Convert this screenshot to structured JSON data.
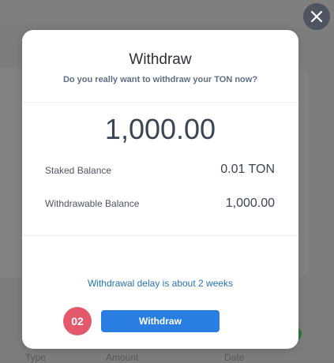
{
  "modal": {
    "title": "Withdraw",
    "subtitle": "Do you really want to withdraw your TON now?",
    "amount": "1,000.00",
    "rows": [
      {
        "label": "Staked Balance",
        "value": "0.01 TON"
      },
      {
        "label": "Withdrawable Balance",
        "value": "1,000.00"
      }
    ],
    "delay_text": "Withdrawal delay is about 2 weeks",
    "step_badge": "02",
    "withdraw_label": "Withdraw"
  },
  "background": {
    "columns": [
      "Type",
      "Amount",
      "Date"
    ]
  },
  "icons": {
    "close": "close-icon"
  },
  "colors": {
    "primary_button": "#2a7de1",
    "step_badge": "#e4586c",
    "link_text": "#2a72b5"
  }
}
